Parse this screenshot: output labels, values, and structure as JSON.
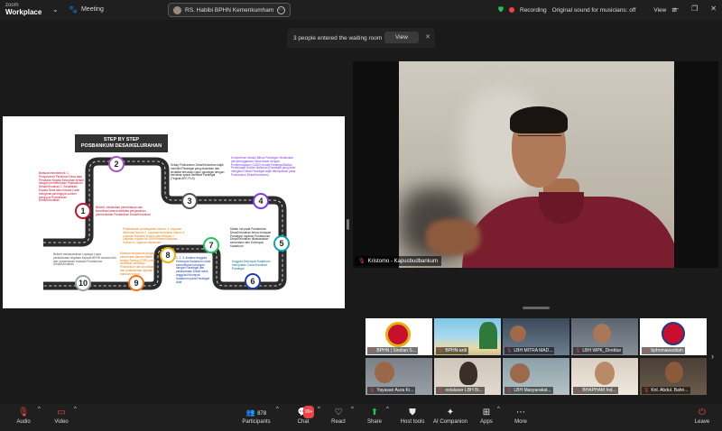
{
  "app": {
    "brand_top": "zoom",
    "brand_bottom": "Workplace"
  },
  "topbar": {
    "meeting_label": "Meeting",
    "room_name": "RS. Habibi BPHN Kemenkumham",
    "recording_label": "Recording",
    "audio_label": "Original sound for musicians: off",
    "view_label": "View"
  },
  "toast": {
    "message": "3 people entered the waiting room",
    "button": "View"
  },
  "slide": {
    "title_line1": "STEP BY STEP",
    "title_line2": "POSBANKUM DESA/KELURAHAN",
    "steps": [
      "1",
      "2",
      "3",
      "4",
      "5",
      "6",
      "7",
      "8",
      "9",
      "10"
    ],
    "ann_red": "Bantuan/membentuk: 1. Penyusunan Peraturan Desa atau Peraturan Kepala Kelurahan terkait dengan pembentukan Posbankum Desa/Kelurahan 2. Sosialisasi Kepala Desa atau Kepala Lurah mengenai pentingnya sumber pengurus Posbankum Desa/Kelurahan",
    "ann_red2": "Bekerti: melakukan pemantauan dan koordinasi sesuai aktivitas pengesahan pembentukan Posbankum Desa/Kelurahan",
    "ann_black": "Setiap Posbankum Desa/Kelurahan wajib memiliki Paralegal yang diusulkan dan terdaftar terhadap calon paralegal dengan berdasar syarat sertifikat Paralegal (Tingkat APC PLA)",
    "ann_purple": "Kompetensi melalui Bilbos Paralegal: Melakukan penyelenggaraan Diklat dasar dengan Pemberdayaan (CASD) terkait Paralegal Badan Pembinaan Hukum Nasional (Paralegal yang telah mengikuti Diklat Paralegal wajib ditempatkan pada Posbankum Desa/Kelurahan)",
    "ann_black2": "Dalam hal pada Posbankum Desa/Kelurahan belum terdapat Paralegal, layanan Posbankum Desa/Kelurahan dilaksanakan sementara oleh Kelompok Kadarkum",
    "ann_teal": "Anggota Kelompok Kadarkum merupakan Calon/Kandidat Paralegal",
    "ann_orange": "Pelaksanaan penanganan hukum: 1. Layanan informasi hukum 2. Layanan konsultasi hukum 3. Layanan Bantuan Hukum dan Mediasi 4. Layanan rujukan ke LBH/Pemberi Bantuan Hukum 5. Layanan Kadarkum",
    "ann_orange2": "Bantuan kerjasama dengan pemerintah daerah dalam rangka Sinergi (CSR) untuk kemitraan terhadap Posbankum dan koordinasi dan pelaksanaan layanan bantuan hukum",
    "ann_blue": "1. 2. 3. Instansi anggota Kelompok Kadarkum untuk memelihara hubungan dengan Paralegal dan pelaksanaan Diklat untuk anggota Kelompok Kadarkum pada Paralegal Aktif",
    "ann_gray": "Bekerti melaksanakan Lapsaya Lapor pelaksanaan kegiatan kepada BPHN secara rutin dan pemantauan evaluasi Posbankum Desa/Kelurahan"
  },
  "speaker": {
    "name": "Kristomo - Kapusbudbankum"
  },
  "gallery": [
    {
      "name": "BPHN | Sindian S..."
    },
    {
      "name": "BPHN-ardi"
    },
    {
      "name": "LBH MITRA MAD..."
    },
    {
      "name": "LBH WPK_Direktur"
    },
    {
      "name": "bphnmawaddah"
    },
    {
      "name": "Yayasan Aura Kr..."
    },
    {
      "name": "ostalaser LBH Bi..."
    },
    {
      "name": "LBH Masyarakat..."
    },
    {
      "name": "BHAPHAM Ind..."
    },
    {
      "name": "Knl. Abdul. Bahri..."
    }
  ],
  "toolbar": {
    "audio": "Audio",
    "video": "Video",
    "participants": "Participants",
    "participants_count": "878",
    "chat": "Chat",
    "chat_badge": "99+",
    "react": "React",
    "share": "Share",
    "host_tools": "Host tools",
    "ai_companion": "AI Companion",
    "apps": "Apps",
    "more": "More",
    "leave": "Leave"
  }
}
